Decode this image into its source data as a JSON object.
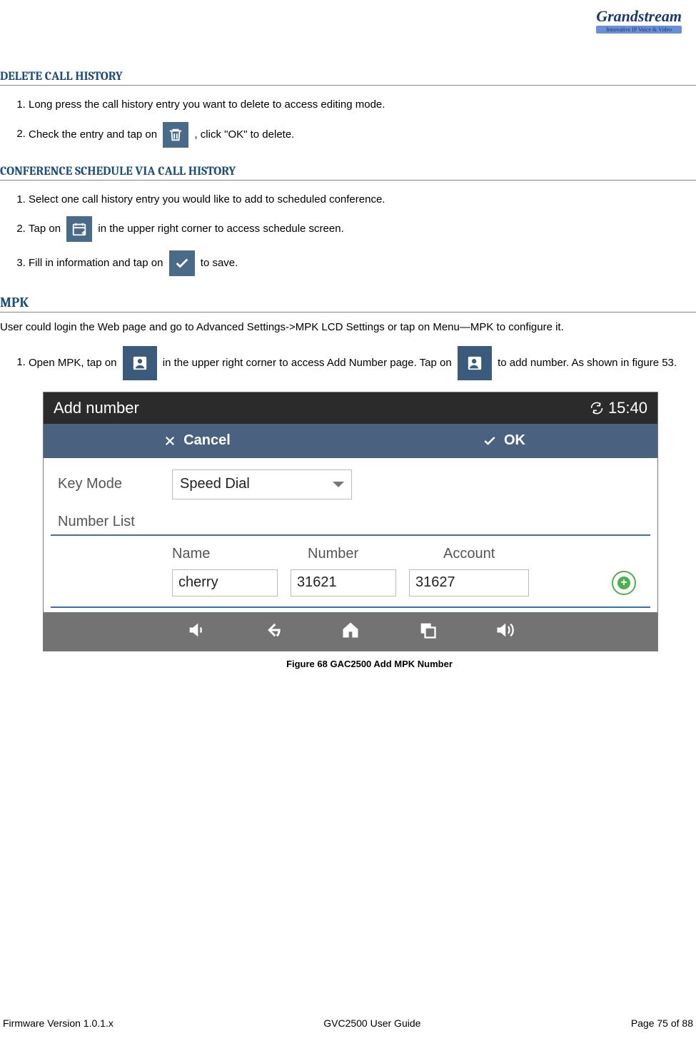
{
  "logo": {
    "main": "Grandstream",
    "sub": "Innovative IP Voice & Video"
  },
  "sections": {
    "delete": {
      "title": "DELETE CALL HISTORY",
      "items": [
        "Long press the call history entry you want to delete to access editing mode.",
        {
          "pre": "Check the entry and tap on ",
          "post": ", click \"OK\" to delete."
        }
      ]
    },
    "conf": {
      "title": "CONFERENCE SCHEDULE VIA CALL HISTORY",
      "items": {
        "i1": "Select one call history entry you would like to add to scheduled conference.",
        "i2_pre": "Tap on ",
        "i2_post": " in the upper right corner to access schedule screen.",
        "i3_pre": "Fill in information and tap on ",
        "i3_post": " to save."
      }
    },
    "mpk": {
      "title": "MPK",
      "intro": "User could login the Web page and go to Advanced Settings->MPK LCD Settings or tap on Menu—MPK to configure it.",
      "step1_pre": "Open MPK, tap on ",
      "step1_mid": " in the upper right corner to access Add Number page. Tap on ",
      "step1_post": " to add number. As shown in figure 53."
    }
  },
  "figure": {
    "title": "Add number",
    "time": "15:40",
    "cancel": "Cancel",
    "ok": "OK",
    "key_mode_label": "Key Mode",
    "key_mode_value": "Speed Dial",
    "number_list_label": "Number List",
    "col_name": "Name",
    "col_number": "Number",
    "col_account": "Account",
    "name_value": "cherry",
    "number_value": "31621",
    "account_value": "31627",
    "caption": "Figure 68 GAC2500 Add MPK Number"
  },
  "footer": {
    "left": "Firmware Version 1.0.1.x",
    "center": "GVC2500 User Guide",
    "right": "Page 75 of 88"
  }
}
